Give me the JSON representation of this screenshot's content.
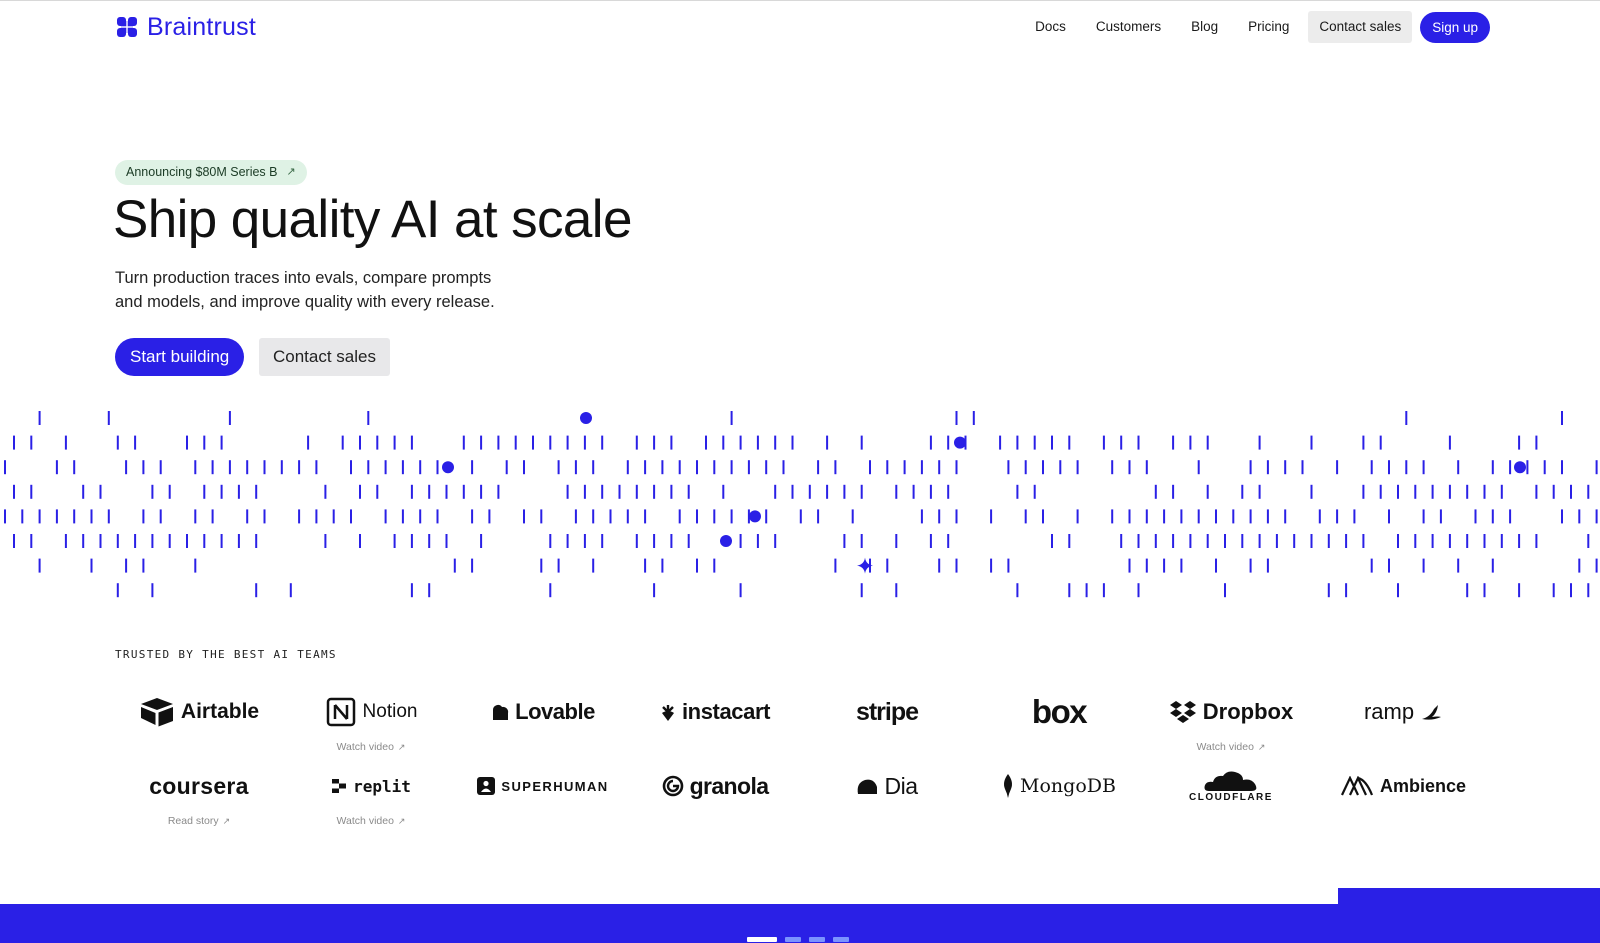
{
  "header": {
    "brand": "Braintrust",
    "nav": [
      "Docs",
      "Customers",
      "Blog",
      "Pricing"
    ],
    "contact_sales": "Contact sales",
    "sign_up": "Sign up"
  },
  "hero": {
    "badge": "Announcing $80M Series B",
    "badge_arrow": "↗",
    "title": "Ship quality AI at scale",
    "subtitle_line1": "Turn production traces into evals, compare prompts",
    "subtitle_line2": "and models, and improve quality with every release.",
    "primary_cta": "Start building",
    "secondary_cta": "Contact sales"
  },
  "trusted": {
    "label": "TRUSTED BY THE BEST AI TEAMS",
    "logos": [
      {
        "name": "Airtable",
        "sub": ""
      },
      {
        "name": "Notion",
        "sub": "Watch video"
      },
      {
        "name": "Lovable",
        "sub": ""
      },
      {
        "name": "instacart",
        "sub": ""
      },
      {
        "name": "stripe",
        "sub": ""
      },
      {
        "name": "box",
        "sub": ""
      },
      {
        "name": "Dropbox",
        "sub": "Watch video"
      },
      {
        "name": "ramp",
        "sub": ""
      },
      {
        "name": "coursera",
        "sub": "Read story"
      },
      {
        "name": "replit",
        "sub": "Watch video"
      },
      {
        "name": "SUPERHUMAN",
        "sub": ""
      },
      {
        "name": "granola",
        "sub": ""
      },
      {
        "name": "Dia",
        "sub": ""
      },
      {
        "name": "MongoDB",
        "sub": ""
      },
      {
        "name": "CLOUDFLARE",
        "sub": ""
      },
      {
        "name": "Ambience",
        "sub": ""
      }
    ],
    "sub_arrow": "↗"
  },
  "carousel": {
    "count": 4,
    "active": 0
  },
  "colors": {
    "accent": "#2a20e6",
    "badge_bg": "#dff2e5",
    "secondary_bg": "#e8e8ea"
  }
}
